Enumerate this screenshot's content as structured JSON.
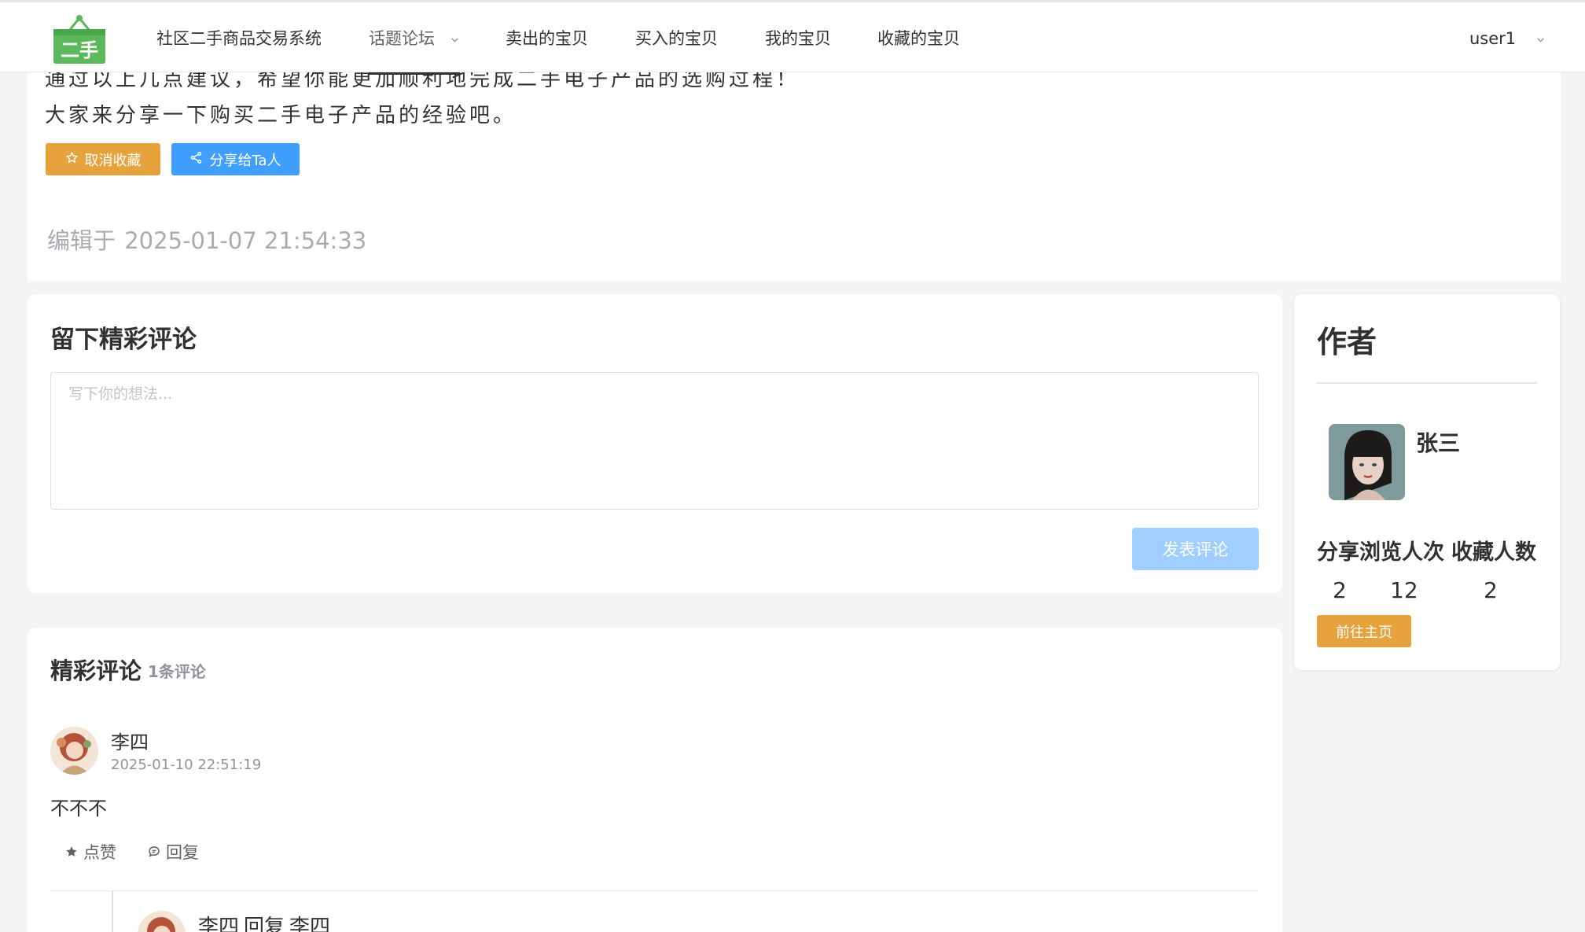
{
  "nav": {
    "logo_text": "二手",
    "items": [
      {
        "label": "社区二手商品交易系统"
      },
      {
        "label": "话题论坛"
      },
      {
        "label": "卖出的宝贝"
      },
      {
        "label": "买入的宝贝"
      },
      {
        "label": "我的宝贝"
      },
      {
        "label": "收藏的宝贝"
      }
    ],
    "user": "user1"
  },
  "article": {
    "line1": "通过以上几点建议，希望你能更加顺利地完成二手电子产品的选购过程！",
    "line2": "大家来分享一下购买二手电子产品的经验吧。",
    "unfavorite_label": "取消收藏",
    "share_label": "分享给Ta人",
    "edited_prefix": "编辑于",
    "edited_time": "2025-01-07 21:54:33"
  },
  "comment_form": {
    "title": "留下精彩评论",
    "placeholder": "写下你的想法...",
    "value": "",
    "submit_label": "发表评论"
  },
  "comments": {
    "title": "精彩评论",
    "count_label": "1条评论",
    "items": [
      {
        "author": "李四",
        "time": "2025-01-10 22:51:19",
        "text": "不不不",
        "like_label": "点赞",
        "reply_label": "回复",
        "replies": [
          {
            "author": "李四",
            "reply_word": "回复",
            "target": "李四"
          }
        ]
      }
    ]
  },
  "author": {
    "title": "作者",
    "name": "张三",
    "stat_label_1": "分享浏览人次",
    "stat_label_2": "收藏人数",
    "stat_value_1": "2",
    "stat_value_2": "12",
    "stat_value_3": "2",
    "home_label": "前往主页"
  },
  "colors": {
    "warning": "#e6a23c",
    "primary": "#409eff",
    "primary_disabled": "#a0cfff",
    "logo_green": "#5cb85c"
  }
}
